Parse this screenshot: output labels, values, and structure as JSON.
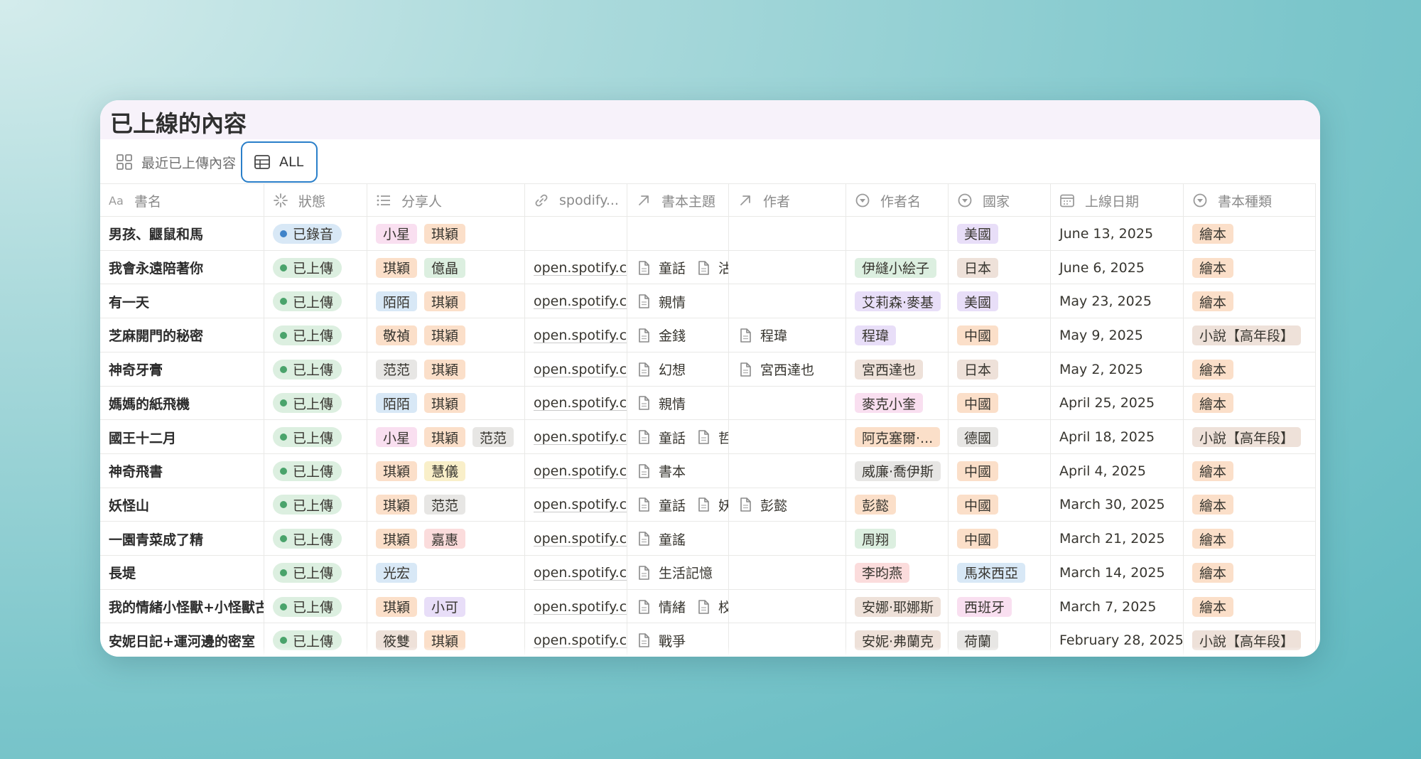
{
  "title": "已上線的內容",
  "tabs": [
    {
      "label": "最近已上傳內容",
      "icon": "gallery-icon"
    },
    {
      "label": "ALL",
      "icon": "table-icon"
    }
  ],
  "columns": [
    {
      "label": "書名",
      "icon": "text-aa-icon"
    },
    {
      "label": "狀態",
      "icon": "status-spinner-icon"
    },
    {
      "label": "分享人",
      "icon": "list-icon"
    },
    {
      "label": "spodify...",
      "icon": "link-icon"
    },
    {
      "label": "書本主題",
      "icon": "relation-arrow-icon"
    },
    {
      "label": "作者",
      "icon": "relation-arrow-icon"
    },
    {
      "label": "作者名",
      "icon": "select-icon"
    },
    {
      "label": "國家",
      "icon": "select-icon"
    },
    {
      "label": "上線日期",
      "icon": "calendar-icon"
    },
    {
      "label": "書本種類",
      "icon": "select-icon"
    }
  ],
  "colors": {
    "purple": "#e8def8",
    "pink": "#f9dff0",
    "orange": "#fbdfc9",
    "green": "#dcefe0",
    "blue": "#d8e8f6",
    "gray": "#e7e6e4",
    "yellow": "#f9efc9",
    "red": "#fbdcdc",
    "brown": "#eee1d9",
    "status_uploaded": "#dcefe0",
    "status_recorded": "#d8e8f6",
    "dot_uploaded": "#4aa36b",
    "dot_recorded": "#3f83c9",
    "tab_focus": "#2a7fc9"
  },
  "rows": [
    {
      "name": "男孩、鼴鼠和馬",
      "status": "已錄音",
      "status_kind": "recorded",
      "sharers": [
        {
          "t": "小星",
          "c": "pink"
        },
        {
          "t": "琪穎",
          "c": "orange"
        }
      ],
      "spotify": "",
      "topics": [],
      "authors": [],
      "author_name": {
        "t": "",
        "c": ""
      },
      "country": {
        "t": "美國",
        "c": "purple"
      },
      "date": "June 13, 2025",
      "type": {
        "t": "繪本",
        "c": "orange"
      }
    },
    {
      "name": "我會永遠陪著你",
      "status": "已上傳",
      "status_kind": "uploaded",
      "sharers": [
        {
          "t": "琪穎",
          "c": "orange"
        },
        {
          "t": "億晶",
          "c": "green"
        }
      ],
      "spotify": "open.spotify.c",
      "topics": [
        "童話",
        "沽"
      ],
      "authors": [],
      "author_name": {
        "t": "伊縫小絵子",
        "c": "green"
      },
      "country": {
        "t": "日本",
        "c": "brown"
      },
      "date": "June 6, 2025",
      "type": {
        "t": "繪本",
        "c": "orange"
      }
    },
    {
      "name": "有一天",
      "status": "已上傳",
      "status_kind": "uploaded",
      "sharers": [
        {
          "t": "陌陌",
          "c": "blue"
        },
        {
          "t": "琪穎",
          "c": "orange"
        }
      ],
      "spotify": "open.spotify.c",
      "topics": [
        "親情"
      ],
      "authors": [],
      "author_name": {
        "t": "艾莉森·麥基",
        "c": "purple"
      },
      "country": {
        "t": "美國",
        "c": "purple"
      },
      "date": "May 23, 2025",
      "type": {
        "t": "繪本",
        "c": "orange"
      }
    },
    {
      "name": "芝麻開門的秘密",
      "status": "已上傳",
      "status_kind": "uploaded",
      "sharers": [
        {
          "t": "敬禎",
          "c": "orange"
        },
        {
          "t": "琪穎",
          "c": "orange"
        }
      ],
      "spotify": "open.spotify.c",
      "topics": [
        "金錢"
      ],
      "authors": [
        "程瑋"
      ],
      "author_name": {
        "t": "程瑋",
        "c": "purple"
      },
      "country": {
        "t": "中國",
        "c": "orange"
      },
      "date": "May 9, 2025",
      "type": {
        "t": "小說【高年段】",
        "c": "brown"
      }
    },
    {
      "name": "神奇牙膏",
      "status": "已上傳",
      "status_kind": "uploaded",
      "sharers": [
        {
          "t": "范范",
          "c": "gray"
        },
        {
          "t": "琪穎",
          "c": "orange"
        }
      ],
      "spotify": "open.spotify.c",
      "topics": [
        "幻想"
      ],
      "authors": [
        "宮西達也"
      ],
      "author_name": {
        "t": "宮西達也",
        "c": "brown"
      },
      "country": {
        "t": "日本",
        "c": "brown"
      },
      "date": "May 2, 2025",
      "type": {
        "t": "繪本",
        "c": "orange"
      }
    },
    {
      "name": "媽媽的紙飛機",
      "status": "已上傳",
      "status_kind": "uploaded",
      "sharers": [
        {
          "t": "陌陌",
          "c": "blue"
        },
        {
          "t": "琪穎",
          "c": "orange"
        }
      ],
      "spotify": "open.spotify.c",
      "topics": [
        "親情"
      ],
      "authors": [],
      "author_name": {
        "t": "麥克小奎",
        "c": "pink"
      },
      "country": {
        "t": "中國",
        "c": "orange"
      },
      "date": "April 25, 2025",
      "type": {
        "t": "繪本",
        "c": "orange"
      }
    },
    {
      "name": "國王十二月",
      "status": "已上傳",
      "status_kind": "uploaded",
      "sharers": [
        {
          "t": "小星",
          "c": "pink"
        },
        {
          "t": "琪穎",
          "c": "orange"
        },
        {
          "t": "范范",
          "c": "gray"
        }
      ],
      "spotify": "open.spotify.c",
      "topics": [
        "童話",
        "哲"
      ],
      "authors": [],
      "author_name": {
        "t": "阿克塞爾·...",
        "c": "orange"
      },
      "country": {
        "t": "德國",
        "c": "gray"
      },
      "date": "April 18, 2025",
      "type": {
        "t": "小說【高年段】",
        "c": "brown"
      }
    },
    {
      "name": "神奇飛書",
      "status": "已上傳",
      "status_kind": "uploaded",
      "sharers": [
        {
          "t": "琪穎",
          "c": "orange"
        },
        {
          "t": "慧儀",
          "c": "yellow"
        }
      ],
      "spotify": "open.spotify.c",
      "topics": [
        "書本"
      ],
      "authors": [],
      "author_name": {
        "t": "威廉·喬伊斯",
        "c": "gray"
      },
      "country": {
        "t": "中國",
        "c": "orange"
      },
      "date": "April 4, 2025",
      "type": {
        "t": "繪本",
        "c": "orange"
      }
    },
    {
      "name": "妖怪山",
      "status": "已上傳",
      "status_kind": "uploaded",
      "sharers": [
        {
          "t": "琪穎",
          "c": "orange"
        },
        {
          "t": "范范",
          "c": "gray"
        }
      ],
      "spotify": "open.spotify.c",
      "topics": [
        "童話",
        "妖"
      ],
      "authors": [
        "彭懿"
      ],
      "author_name": {
        "t": "彭懿",
        "c": "orange"
      },
      "country": {
        "t": "中國",
        "c": "orange"
      },
      "date": "March 30, 2025",
      "type": {
        "t": "繪本",
        "c": "orange"
      }
    },
    {
      "name": "一園青菜成了精",
      "status": "已上傳",
      "status_kind": "uploaded",
      "sharers": [
        {
          "t": "琪穎",
          "c": "orange"
        },
        {
          "t": "嘉惠",
          "c": "red"
        }
      ],
      "spotify": "open.spotify.c",
      "topics": [
        "童謠"
      ],
      "authors": [],
      "author_name": {
        "t": "周翔",
        "c": "green"
      },
      "country": {
        "t": "中國",
        "c": "orange"
      },
      "date": "March 21, 2025",
      "type": {
        "t": "繪本",
        "c": "orange"
      }
    },
    {
      "name": "長堤",
      "status": "已上傳",
      "status_kind": "uploaded",
      "sharers": [
        {
          "t": "光宏",
          "c": "blue"
        }
      ],
      "spotify": "open.spotify.c",
      "topics": [
        "生活記憶"
      ],
      "authors": [],
      "author_name": {
        "t": "李昀燕",
        "c": "red"
      },
      "country": {
        "t": "馬來西亞",
        "c": "blue"
      },
      "date": "March 14, 2025",
      "type": {
        "t": "繪本",
        "c": "orange"
      }
    },
    {
      "name": "我的情緒小怪獸+小怪獸古",
      "status": "已上傳",
      "status_kind": "uploaded",
      "sharers": [
        {
          "t": "琪穎",
          "c": "orange"
        },
        {
          "t": "小可",
          "c": "purple"
        }
      ],
      "spotify": "open.spotify.c",
      "topics": [
        "情緒",
        "校"
      ],
      "authors": [],
      "author_name": {
        "t": "安娜·耶娜斯",
        "c": "brown"
      },
      "country": {
        "t": "西班牙",
        "c": "pink"
      },
      "date": "March 7, 2025",
      "type": {
        "t": "繪本",
        "c": "orange"
      }
    },
    {
      "name": "安妮日記+運河邊的密室",
      "status": "已上傳",
      "status_kind": "uploaded",
      "sharers": [
        {
          "t": "筱雙",
          "c": "brown"
        },
        {
          "t": "琪穎",
          "c": "orange"
        }
      ],
      "spotify": "open.spotify.c",
      "topics": [
        "戰爭"
      ],
      "authors": [],
      "author_name": {
        "t": "安妮·弗蘭克",
        "c": "brown"
      },
      "country": {
        "t": "荷蘭",
        "c": "gray"
      },
      "date": "February 28, 2025",
      "type": {
        "t": "小說【高年段】",
        "c": "brown"
      }
    }
  ]
}
